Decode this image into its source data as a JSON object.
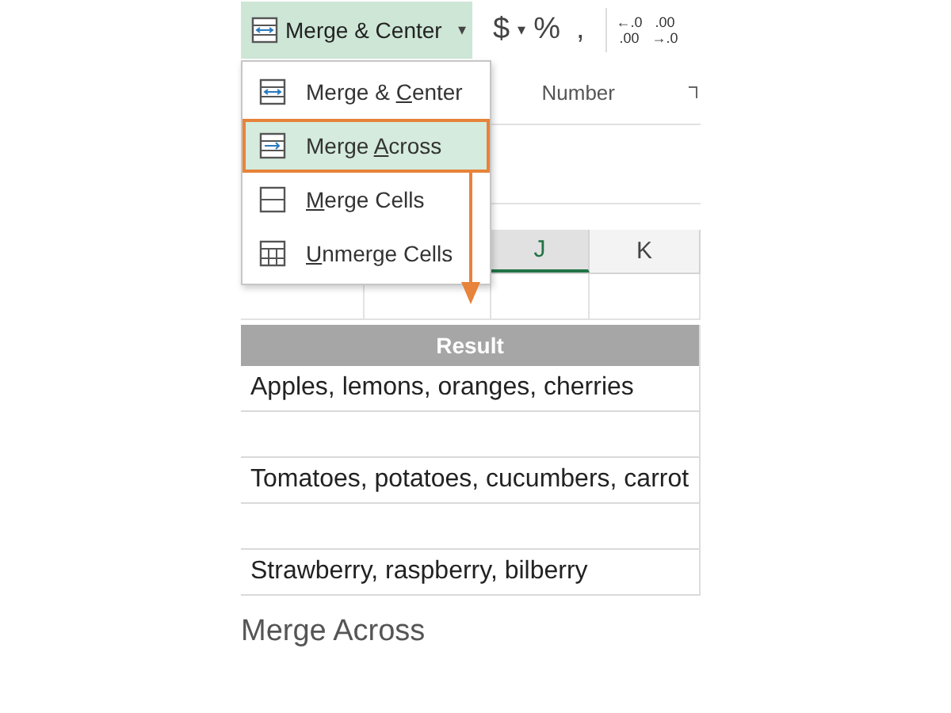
{
  "ribbon": {
    "merge_button": {
      "label": "Merge & Center",
      "caret": "▾",
      "selected": true
    },
    "currency": "$",
    "currency_caret": "▾",
    "percent": "%",
    "comma": ",",
    "decimal_buttons": [
      {
        "top": "←.0",
        "bottom": ".00"
      },
      {
        "top": ".00",
        "bottom": "→.0"
      }
    ],
    "group_label": "Number"
  },
  "merge_menu": {
    "items": [
      {
        "kind": "center",
        "label": {
          "before": "Merge & ",
          "key": "C",
          "after": "enter"
        },
        "selected": false
      },
      {
        "kind": "across",
        "label": {
          "before": "Merge ",
          "key": "A",
          "after": "cross"
        },
        "selected": true
      },
      {
        "kind": "cells",
        "label": {
          "key": "M",
          "after": "erge Cells"
        },
        "selected": false
      },
      {
        "kind": "unmerge",
        "label": {
          "key": "U",
          "after": "nmerge Cells"
        },
        "selected": false
      }
    ]
  },
  "columns": [
    {
      "label": "J",
      "selected": true
    },
    {
      "label": "K",
      "selected": false
    }
  ],
  "result_table": {
    "header": "Result",
    "rows": [
      "Apples, lemons, oranges, cherries",
      "",
      "Tomatoes, potatoes, cucumbers, carrot",
      "",
      "Strawberry, raspberry, bilberry"
    ]
  },
  "caption": "Merge Across"
}
